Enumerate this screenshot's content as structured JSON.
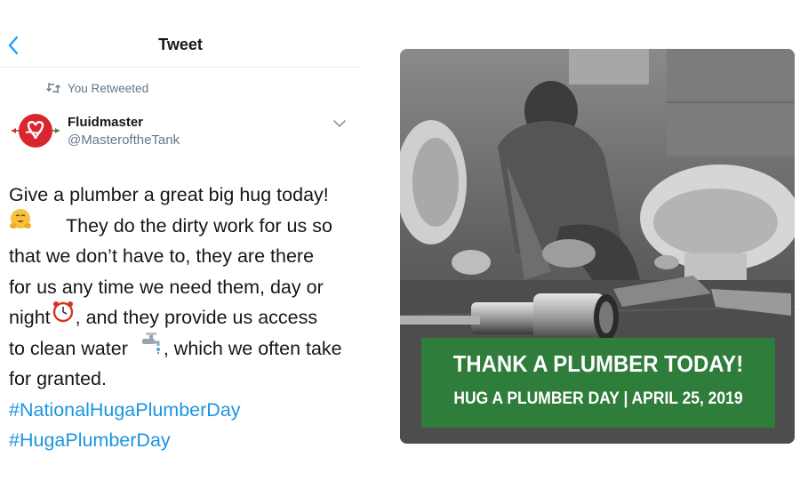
{
  "header": {
    "title": "Tweet",
    "back_icon": "chevron-left-icon"
  },
  "retweet": {
    "label": "You Retweeted",
    "icon": "retweet-icon"
  },
  "author": {
    "name": "Fluidmaster",
    "handle": "@MasteroftheTank",
    "avatar_icon": "fluidmaster-logo",
    "menu_icon": "chevron-down-icon"
  },
  "tweet": {
    "lines": [
      "Give a plumber a great big hug today!",
      "They do the dirty work for us so",
      "that we don’t have to, they are there",
      "for us any time we need them, day or",
      "night",
      ", and they provide us access",
      "to clean water",
      ", which we often take",
      "for granted."
    ],
    "hashtags": [
      "#NationalHugaPlumberDay",
      "#HugaPlumberDay"
    ],
    "emojis": [
      "hugging-face-emoji",
      "alarm-clock-emoji",
      "faucet-emoji"
    ]
  },
  "image": {
    "banner_title": "THANK A PLUMBER TODAY!",
    "banner_subtitle": "HUG A PLUMBER DAY | APRIL 25, 2019"
  },
  "colors": {
    "hashtag": "#1b95e0",
    "secondary_text": "#657786",
    "banner_green": "#2f7d3a",
    "logo_red": "#d9262e"
  }
}
